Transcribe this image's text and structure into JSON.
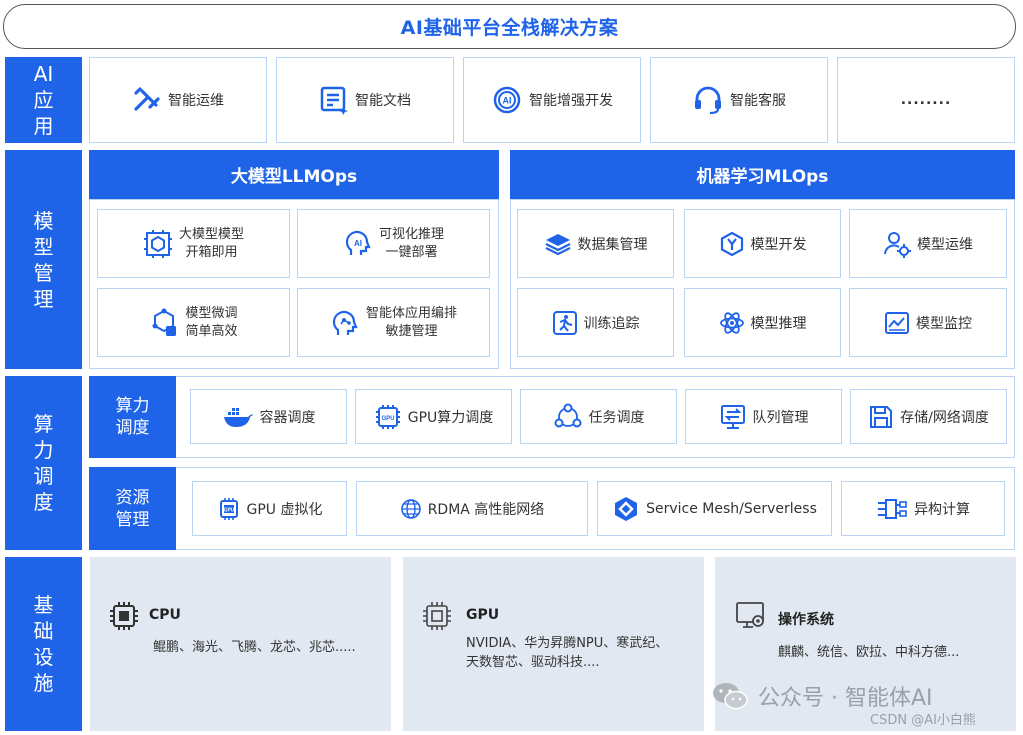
{
  "title": "AI基础平台全栈解决方案",
  "rows": {
    "ai_app": "AI应用",
    "model_mgmt": "模型管理",
    "compute": "算力调度",
    "infra": "基础设施"
  },
  "ai_apps": [
    "智能运维",
    "智能文档",
    "智能增强开发",
    "智能客服",
    "........"
  ],
  "llmops": {
    "header": "大模型LLMOps",
    "items": [
      {
        "line1": "大模型模型",
        "line2": "开箱即用"
      },
      {
        "line1": "可视化推理",
        "line2": "一键部署"
      },
      {
        "line1": "模型微调",
        "line2": "简单高效"
      },
      {
        "line1": "智能体应用编排",
        "line2": "敏捷管理"
      }
    ]
  },
  "mlops": {
    "header": "机器学习MLOps",
    "items": [
      "数据集管理",
      "模型开发",
      "模型运维",
      "训练追踪",
      "模型推理",
      "模型监控"
    ]
  },
  "scheduling": {
    "label": "算力调度",
    "items": [
      "容器调度",
      "GPU算力调度",
      "任务调度",
      "队列管理",
      "存储/网络调度"
    ]
  },
  "resources": {
    "label": "资源管理",
    "items": [
      "GPU 虚拟化",
      "RDMA 高性能网络",
      "Service Mesh/Serverless",
      "异构计算"
    ]
  },
  "infra": {
    "cpu": {
      "title": "CPU",
      "text": "鲲鹏、海光、飞腾、龙芯、兆芯....."
    },
    "gpu": {
      "title": "GPU",
      "line1": "NVIDIA、华为昇腾NPU、寒武纪、",
      "line2": "天数智芯、驱动科技...."
    },
    "os": {
      "title": "操作系统",
      "text": "麒麟、统信、欧拉、中科方德..."
    }
  },
  "watermark": {
    "main": "公众号 · 智能体AI",
    "sub": "CSDN @AI小白熊"
  },
  "colors": {
    "accent": "#1f64e8",
    "border": "#b9d4f3",
    "infra_bg": "#e2e8f1"
  }
}
